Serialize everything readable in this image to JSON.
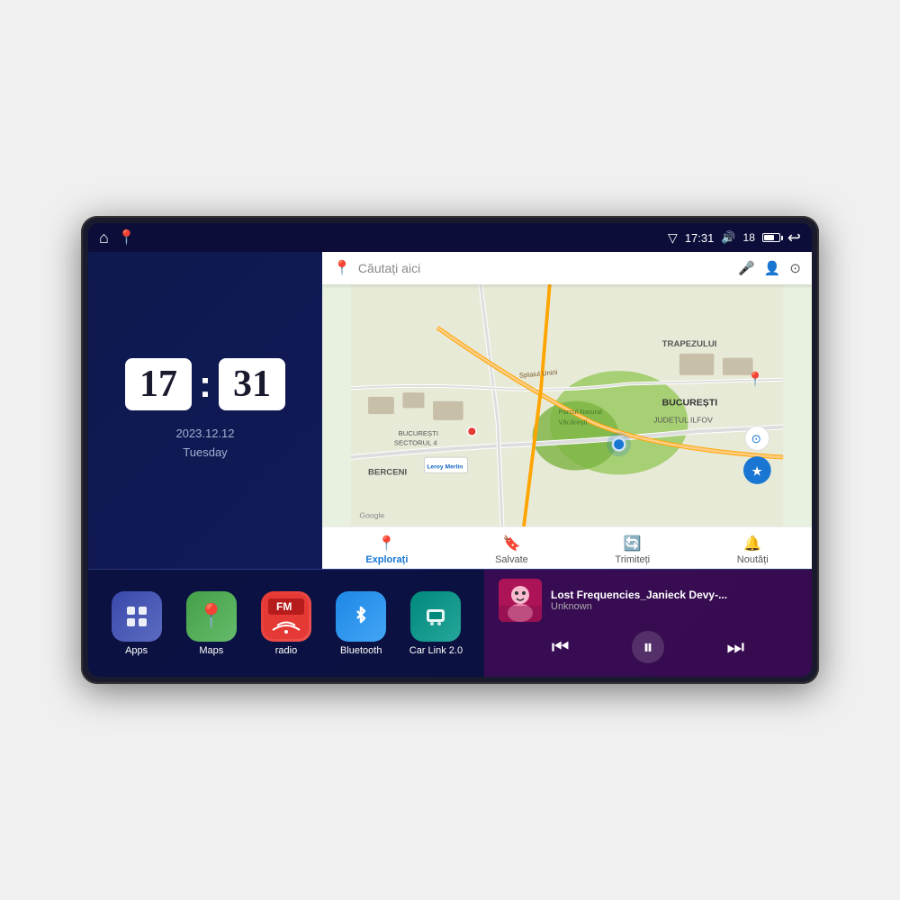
{
  "device": {
    "status_bar": {
      "signal_icon": "▽",
      "time": "17:31",
      "volume_icon": "🔊",
      "volume_level": "18",
      "battery_label": "⬜",
      "back_icon": "↩",
      "home_icon": "⌂",
      "maps_icon": "📍"
    },
    "clock": {
      "hour": "17",
      "minute": "31",
      "date": "2023.12.12",
      "day": "Tuesday"
    },
    "map": {
      "search_placeholder": "Căutați aici",
      "footer_items": [
        {
          "label": "Explorați",
          "icon": "📍",
          "active": true
        },
        {
          "label": "Salvate",
          "icon": "🔖",
          "active": false
        },
        {
          "label": "Trimiteți",
          "icon": "🔄",
          "active": false
        },
        {
          "label": "Noutăți",
          "icon": "🔔",
          "active": false
        }
      ],
      "locations": [
        "TRAPEZULUI",
        "BUCUREȘTI",
        "JUDEȚUL ILFOV",
        "BERCENI",
        "Parcul Natural Văcărești",
        "Leroy Merlin",
        "BUCUREȘTI SECTORUL 4"
      ]
    },
    "apps": [
      {
        "id": "apps",
        "label": "Apps",
        "icon": "⊞",
        "color_class": "app-apps"
      },
      {
        "id": "maps",
        "label": "Maps",
        "icon": "📍",
        "color_class": "app-maps"
      },
      {
        "id": "radio",
        "label": "radio",
        "icon": "📻",
        "color_class": "app-radio"
      },
      {
        "id": "bluetooth",
        "label": "Bluetooth",
        "icon": "🔷",
        "color_class": "app-bluetooth"
      },
      {
        "id": "carlink",
        "label": "Car Link 2.0",
        "icon": "📱",
        "color_class": "app-carlink"
      }
    ],
    "music": {
      "title": "Lost Frequencies_Janieck Devy-...",
      "artist": "Unknown",
      "prev_icon": "⏮",
      "play_icon": "⏸",
      "next_icon": "⏭"
    }
  }
}
